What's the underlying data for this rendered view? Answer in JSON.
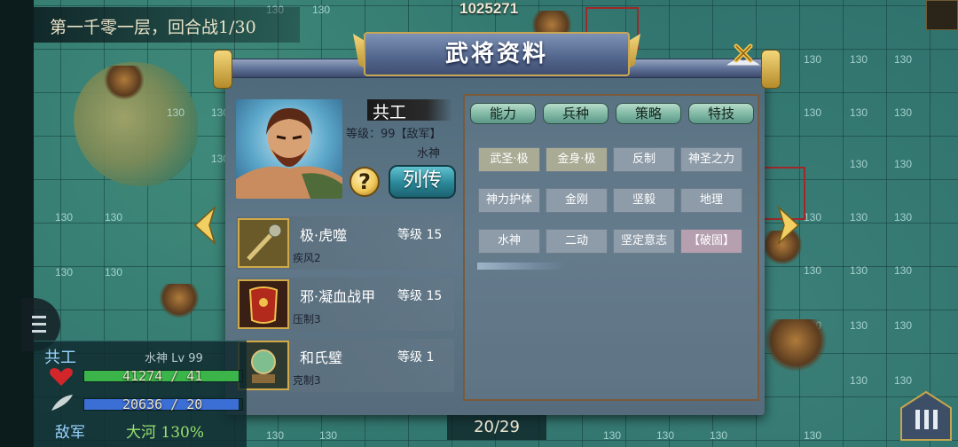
{
  "hud": {
    "battle_info": "第一千零一层，回合战1/30",
    "power": "1025271",
    "tile_number": "130"
  },
  "dialog": {
    "title": "武将资料",
    "name": "共工",
    "level_line": "等级：99【敌军】",
    "terrain": "水神",
    "help_label": "?",
    "bio_button": "列传"
  },
  "equipment": [
    {
      "name": "极·虎噬",
      "level": "等级 15",
      "skill": "疾风2",
      "icon": "mace-icon"
    },
    {
      "name": "邪·凝血战甲",
      "level": "等级 15",
      "skill": "压制3",
      "icon": "armor-icon"
    },
    {
      "name": "和氏璧",
      "level": "等级 1",
      "skill": "克制3",
      "icon": "jade-icon"
    }
  ],
  "tabs": [
    "能力",
    "兵种",
    "策略",
    "特技"
  ],
  "skills": [
    [
      "武圣·极",
      "金身·极",
      "反制",
      "神圣之力"
    ],
    [
      "神力护体",
      "金刚",
      "坚毅",
      "地理"
    ],
    [
      "水神",
      "二动",
      "坚定意志",
      "【破固】"
    ]
  ],
  "page_counter": "20/29",
  "status": {
    "name": "共工",
    "subtitle": "水神 Lv 99",
    "hp_text": "41274 / 41",
    "hp_fraction": 0.98,
    "mp_text": "20636 / 20",
    "mp_fraction": 0.98,
    "side": "敌军",
    "terrain_bonus": "大河 130%"
  },
  "colors": {
    "hp_bar": "#3bb54a",
    "mp_bar": "#3b6fd6",
    "panel_border": "#7b5a3a"
  }
}
